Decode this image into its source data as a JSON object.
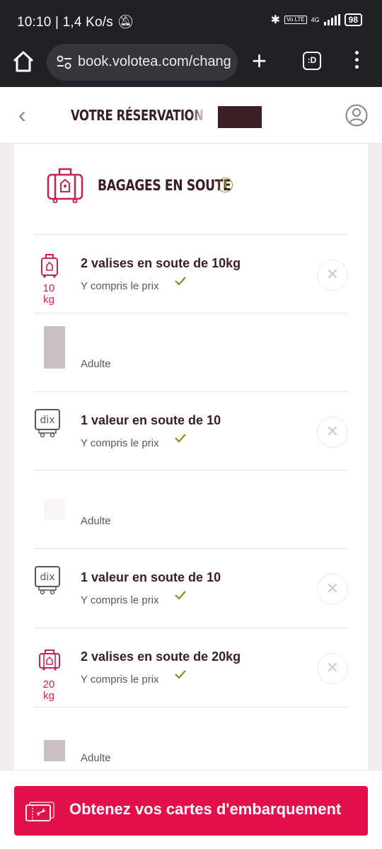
{
  "status_bar": {
    "time": "10:10",
    "net_speed": "1,4 Ko/s",
    "network": "4G",
    "volte": "Vo LTE",
    "battery": "98"
  },
  "browser": {
    "url": "book.volotea.com/chang",
    "tabs_label": ":D"
  },
  "header": {
    "title": "VOTRE RÉSERVATION"
  },
  "section": {
    "title": "BAGAGES EN SOUTE"
  },
  "items": [
    {
      "type": "bag",
      "title": "2 valises en soute de 10kg",
      "subtitle": "Y compris le prix",
      "weight": "10",
      "unit": "kg"
    },
    {
      "type": "person",
      "label": "Adulte"
    },
    {
      "type": "valuable",
      "title": "1 valeur en soute de 10",
      "subtitle": "Y compris le prix",
      "icon_text": "dix"
    },
    {
      "type": "person",
      "label": "Adulte"
    },
    {
      "type": "valuable",
      "title": "1 valeur en soute de 10",
      "subtitle": "Y compris le prix",
      "icon_text": "dix"
    },
    {
      "type": "bag",
      "title": "2 valises en soute de 20kg",
      "subtitle": "Y compris le prix",
      "weight": "20",
      "unit": "kg"
    },
    {
      "type": "person",
      "label": "Adulte"
    }
  ],
  "cta": {
    "label": "Obtenez vos cartes d'embarquement"
  },
  "colors": {
    "brand": "#e3114b",
    "dark_text": "#3a1e24",
    "check": "#8e8a1a",
    "icon_red": "#c4244f"
  }
}
